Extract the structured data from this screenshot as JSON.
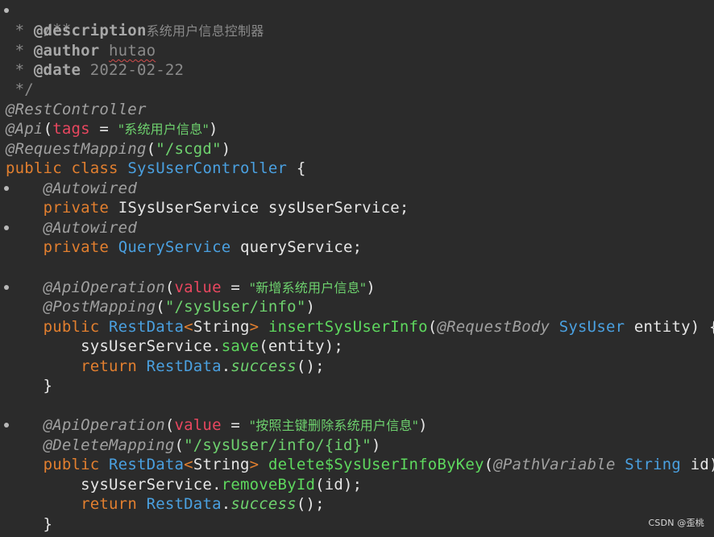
{
  "colors": {
    "background": "#2b2b2b",
    "keyword": "#e27f2f",
    "type": "#4aa0e0",
    "string": "#6ed26e",
    "annotation": "#a0a0a0",
    "comment": "#8a8a8a",
    "attribute": "#e8475f"
  },
  "code": {
    "l1": {
      "text": "/**"
    },
    "l2": {
      "star": " * ",
      "tag": "@description",
      "value": "系统用户信息控制器"
    },
    "l3": {
      "star": " * ",
      "tag": "@author",
      "sp": " ",
      "value": "hutao"
    },
    "l4": {
      "star": " * ",
      "tag": "@date",
      "sp": " ",
      "value": "2022-02-22"
    },
    "l5": {
      "text": " */"
    },
    "l6": {
      "annot": "@RestController"
    },
    "l7": {
      "annot": "@Api",
      "p1": "(",
      "attr": "tags",
      "eq": " = ",
      "str": "\"系统用户信息\"",
      "p2": ")"
    },
    "l8": {
      "annot": "@RequestMapping",
      "p1": "(",
      "str": "\"/scgd\"",
      "p2": ")"
    },
    "l9": {
      "kw1": "public",
      "sp1": " ",
      "kw2": "class",
      "sp2": " ",
      "type": "SysUserController",
      "rest": " {"
    },
    "l10": {
      "indent": "    ",
      "annot": "@Autowired"
    },
    "l11": {
      "indent": "    ",
      "kw": "private",
      "sp": " ",
      "type": "ISysUserService",
      "rest": " sysUserService;"
    },
    "l12": {
      "indent": "    ",
      "annot": "@Autowired"
    },
    "l13": {
      "indent": "    ",
      "kw": "private",
      "sp": " ",
      "type": "QueryService",
      "rest": " queryService;"
    },
    "l14": {
      "indent": "    ",
      "annot": "@ApiOperation",
      "p1": "(",
      "attr": "value",
      "eq": " = ",
      "str": "\"新增系统用户信息\"",
      "p2": ")"
    },
    "l15": {
      "indent": "    ",
      "annot": "@PostMapping",
      "p1": "(",
      "str": "\"/sysUser/info\"",
      "p2": ")"
    },
    "l16": {
      "indent": "    ",
      "kw": "public",
      "sp": " ",
      "type1": "RestData",
      "lt": "<",
      "type2": "String",
      "gt": ">",
      "sp2": " ",
      "method": "insertSysUserInfo",
      "p1": "(",
      "annot": "@RequestBody",
      "sp3": " ",
      "type3": "SysUser",
      "sp4": " ",
      "param": "entity",
      "rest": ") {"
    },
    "l17": {
      "indent": "        ",
      "obj": "sysUserService",
      "dot": ".",
      "method": "save",
      "rest": "(entity);"
    },
    "l18": {
      "indent": "        ",
      "kw": "return",
      "sp": " ",
      "type": "RestData",
      "dot": ".",
      "static": "success",
      "rest": "();"
    },
    "l19": {
      "text": "    }"
    },
    "l20": {
      "indent": "    ",
      "annot": "@ApiOperation",
      "p1": "(",
      "attr": "value",
      "eq": " = ",
      "str": "\"按照主键删除系统用户信息\"",
      "p2": ")"
    },
    "l21": {
      "indent": "    ",
      "annot": "@DeleteMapping",
      "p1": "(",
      "str": "\"/sysUser/info/{id}\"",
      "p2": ")"
    },
    "l22": {
      "indent": "    ",
      "kw": "public",
      "sp": " ",
      "type1": "RestData",
      "lt": "<",
      "type2": "String",
      "gt": ">",
      "sp2": " ",
      "method": "delete$SysUserInfoByKey",
      "p1": "(",
      "annot": "@PathVariable",
      "sp3": " ",
      "type3": "String",
      "sp4": " ",
      "param": "id",
      "rest": ") {"
    },
    "l23": {
      "indent": "        ",
      "obj": "sysUserService",
      "dot": ".",
      "method": "removeById",
      "rest": "(id);"
    },
    "l24": {
      "indent": "        ",
      "kw": "return",
      "sp": " ",
      "type": "RestData",
      "dot": ".",
      "static": "success",
      "rest": "();"
    },
    "l25": {
      "text": "    }"
    }
  },
  "watermark": "CSDN @歪桃"
}
